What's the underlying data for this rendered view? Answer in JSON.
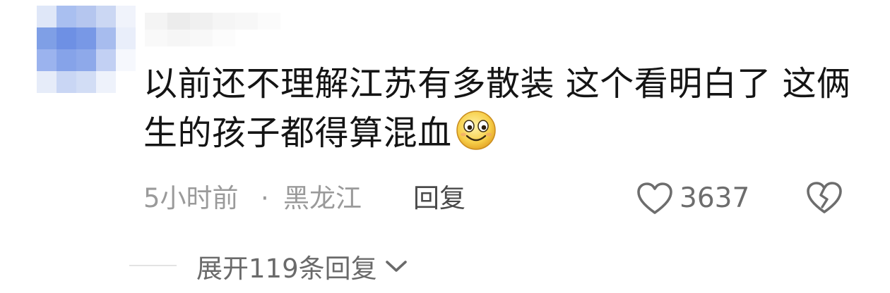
{
  "comment": {
    "text": "以前还不理解江苏有多散装 这个看明白了 这俩生的孩子都得算混血",
    "emoji": "smiling-face-emoji"
  },
  "meta": {
    "time": "5小时前",
    "separator": "·",
    "location": "黑龙江",
    "reply_label": "回复"
  },
  "likes": {
    "count": "3637"
  },
  "replies": {
    "expand_label": "展开119条回复"
  },
  "icons": {
    "like": "heart-outline-icon",
    "dislike": "broken-heart-icon",
    "expand": "chevron-down-icon"
  },
  "colors": {
    "text": "#141414",
    "meta": "#9a9a9a",
    "reply": "#4a4a4a",
    "icon": "#6d6d6d",
    "avatar_blue": "#7fa2e8"
  }
}
